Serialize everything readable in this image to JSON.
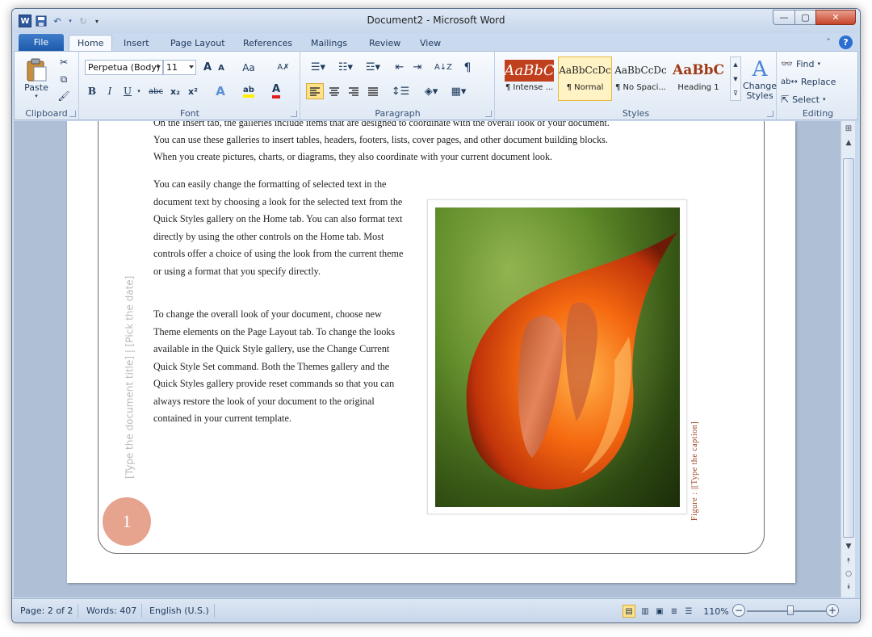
{
  "window": {
    "title": "Document2  -  Microsoft Word"
  },
  "qat": {
    "word_icon": "W"
  },
  "tabs": {
    "file": "File",
    "items": [
      "Home",
      "Insert",
      "Page Layout",
      "References",
      "Mailings",
      "Review",
      "View"
    ]
  },
  "clipboard": {
    "paste": "Paste",
    "label": "Clipboard"
  },
  "font": {
    "name": "Perpetua (Body)",
    "size": "11",
    "label": "Font",
    "bold": "B",
    "italic": "I",
    "underline": "U",
    "strike": "abc",
    "sub": "x₂",
    "sup": "x²",
    "change_case": "Aa",
    "grow": "A",
    "shrink": "A",
    "font_color": "A",
    "highlight": "ab",
    "effects": "A"
  },
  "paragraph": {
    "label": "Paragraph",
    "sort": "A↓Z",
    "pilcrow": "¶"
  },
  "styles": {
    "label": "Styles",
    "items": [
      {
        "sample": "AaBbC",
        "name": "¶ Intense ..."
      },
      {
        "sample": "AaBbCcDc",
        "name": "¶ Normal"
      },
      {
        "sample": "AaBbCcDc",
        "name": "¶ No Spaci..."
      },
      {
        "sample": "AaBbC",
        "name": "Heading 1"
      }
    ],
    "change_line1": "Change",
    "change_line2": "Styles"
  },
  "editing": {
    "label": "Editing",
    "find": "Find",
    "replace": "Replace",
    "select": "Select"
  },
  "document": {
    "top_partial": "On the Insert tab, the galleries include items that are designed to coordinate with the overall look of your document.",
    "top_para_line1": "You can use these galleries to insert tables, headers, footers, lists, cover pages, and other document building blocks.",
    "top_para_line2": "When you create pictures, charts, or diagrams, they also coordinate with your current document look.",
    "para2": "You can easily change the formatting of selected text in the document text by choosing a look for the selected text from the Quick Styles gallery on the Home tab. You can also format text directly by using the other controls on the Home tab. Most controls offer a choice of using the look from the current theme or using a format that you specify directly.",
    "para3": "To change the overall look of your document, choose new Theme elements on the Page Layout tab. To change the looks available in the Quick Style gallery, use the Change Current Quick Style Set command. Both the Themes gallery and the Quick Styles gallery provide reset commands so that you can always restore the look of your document to the original contained in your current template.",
    "sidebar_placeholder": "[Type the document title]  |  [Pick the date]",
    "page_number": "1",
    "caption": "Figure : |[Type the caption]"
  },
  "status": {
    "page": "Page: 2 of 2",
    "words": "Words: 407",
    "language": "English (U.S.)",
    "zoom": "110%",
    "zoom_level": 0.55
  },
  "colors": {
    "accent": "#2b579a",
    "page_number_circle": "#e6a38e",
    "caption": "#9a3b1a"
  }
}
